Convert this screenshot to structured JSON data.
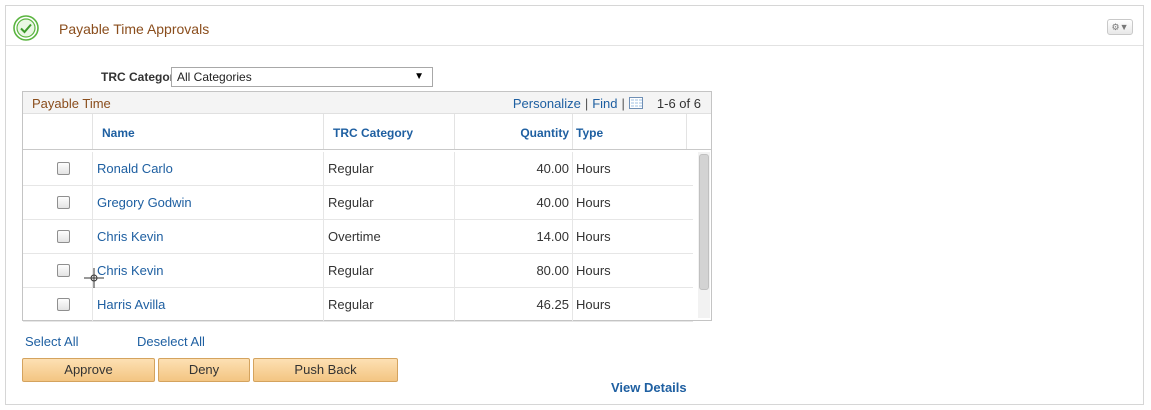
{
  "header": {
    "title": "Payable Time Approvals",
    "status_icon": "check-circle-icon",
    "settings_icon": "gear-icon"
  },
  "filter": {
    "label": "TRC Category",
    "selected": "All Categories"
  },
  "grid": {
    "title": "Payable Time",
    "personalize": "Personalize",
    "find": "Find",
    "count": "1-6 of 6",
    "columns": [
      "Name",
      "TRC Category",
      "Quantity",
      "Type"
    ],
    "rows": [
      {
        "name": "Ronald Carlo",
        "trc": "Regular",
        "quantity": "40.00",
        "type": "Hours"
      },
      {
        "name": "Gregory Godwin",
        "trc": "Regular",
        "quantity": "40.00",
        "type": "Hours"
      },
      {
        "name": "Chris Kevin",
        "trc": "Overtime",
        "quantity": "14.00",
        "type": "Hours"
      },
      {
        "name": "Chris Kevin",
        "trc": "Regular",
        "quantity": "80.00",
        "type": "Hours"
      },
      {
        "name": "Harris Avilla",
        "trc": "Regular",
        "quantity": "46.25",
        "type": "Hours"
      }
    ]
  },
  "actions": {
    "select_all": "Select All",
    "deselect_all": "Deselect All",
    "approve": "Approve",
    "deny": "Deny",
    "push_back": "Push Back",
    "view_details": "View Details"
  },
  "colors": {
    "title": "#8a4d1c",
    "link": "#1e5fa1",
    "button": "#f3c582",
    "check_green": "#5bb540"
  }
}
